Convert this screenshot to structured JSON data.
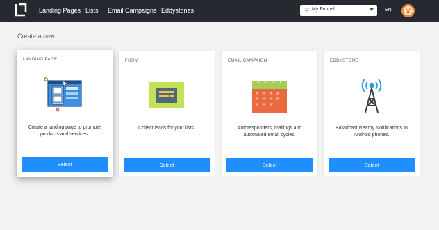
{
  "nav": {
    "links": [
      "Landing Pages",
      "Lists",
      "Email Campaigns",
      "Eddystones"
    ],
    "funnel_select": "My Funnel",
    "language": "EN"
  },
  "main": {
    "heading": "Create a new...",
    "cards": [
      {
        "label": "LANDING PAGE",
        "description": "Create a landing page to promote products and services.",
        "button": "Select",
        "illustration": "landing-page-icon"
      },
      {
        "label": "FORM",
        "description": "Collect leads for your lists.",
        "button": "Select",
        "illustration": "form-icon"
      },
      {
        "label": "EMAIL CAMPAIGN",
        "description": "Autoresponders, mailings and automated email cycles.",
        "button": "Select",
        "illustration": "calendar-icon"
      },
      {
        "label": "EDDYSTONE",
        "description": "Broadcast Nearby Notifications to Android phones.",
        "button": "Select",
        "illustration": "beacon-tower-icon"
      }
    ]
  },
  "colors": {
    "topbar": "#262930",
    "button": "#1f8fff",
    "avatar": "#f08a3c"
  }
}
